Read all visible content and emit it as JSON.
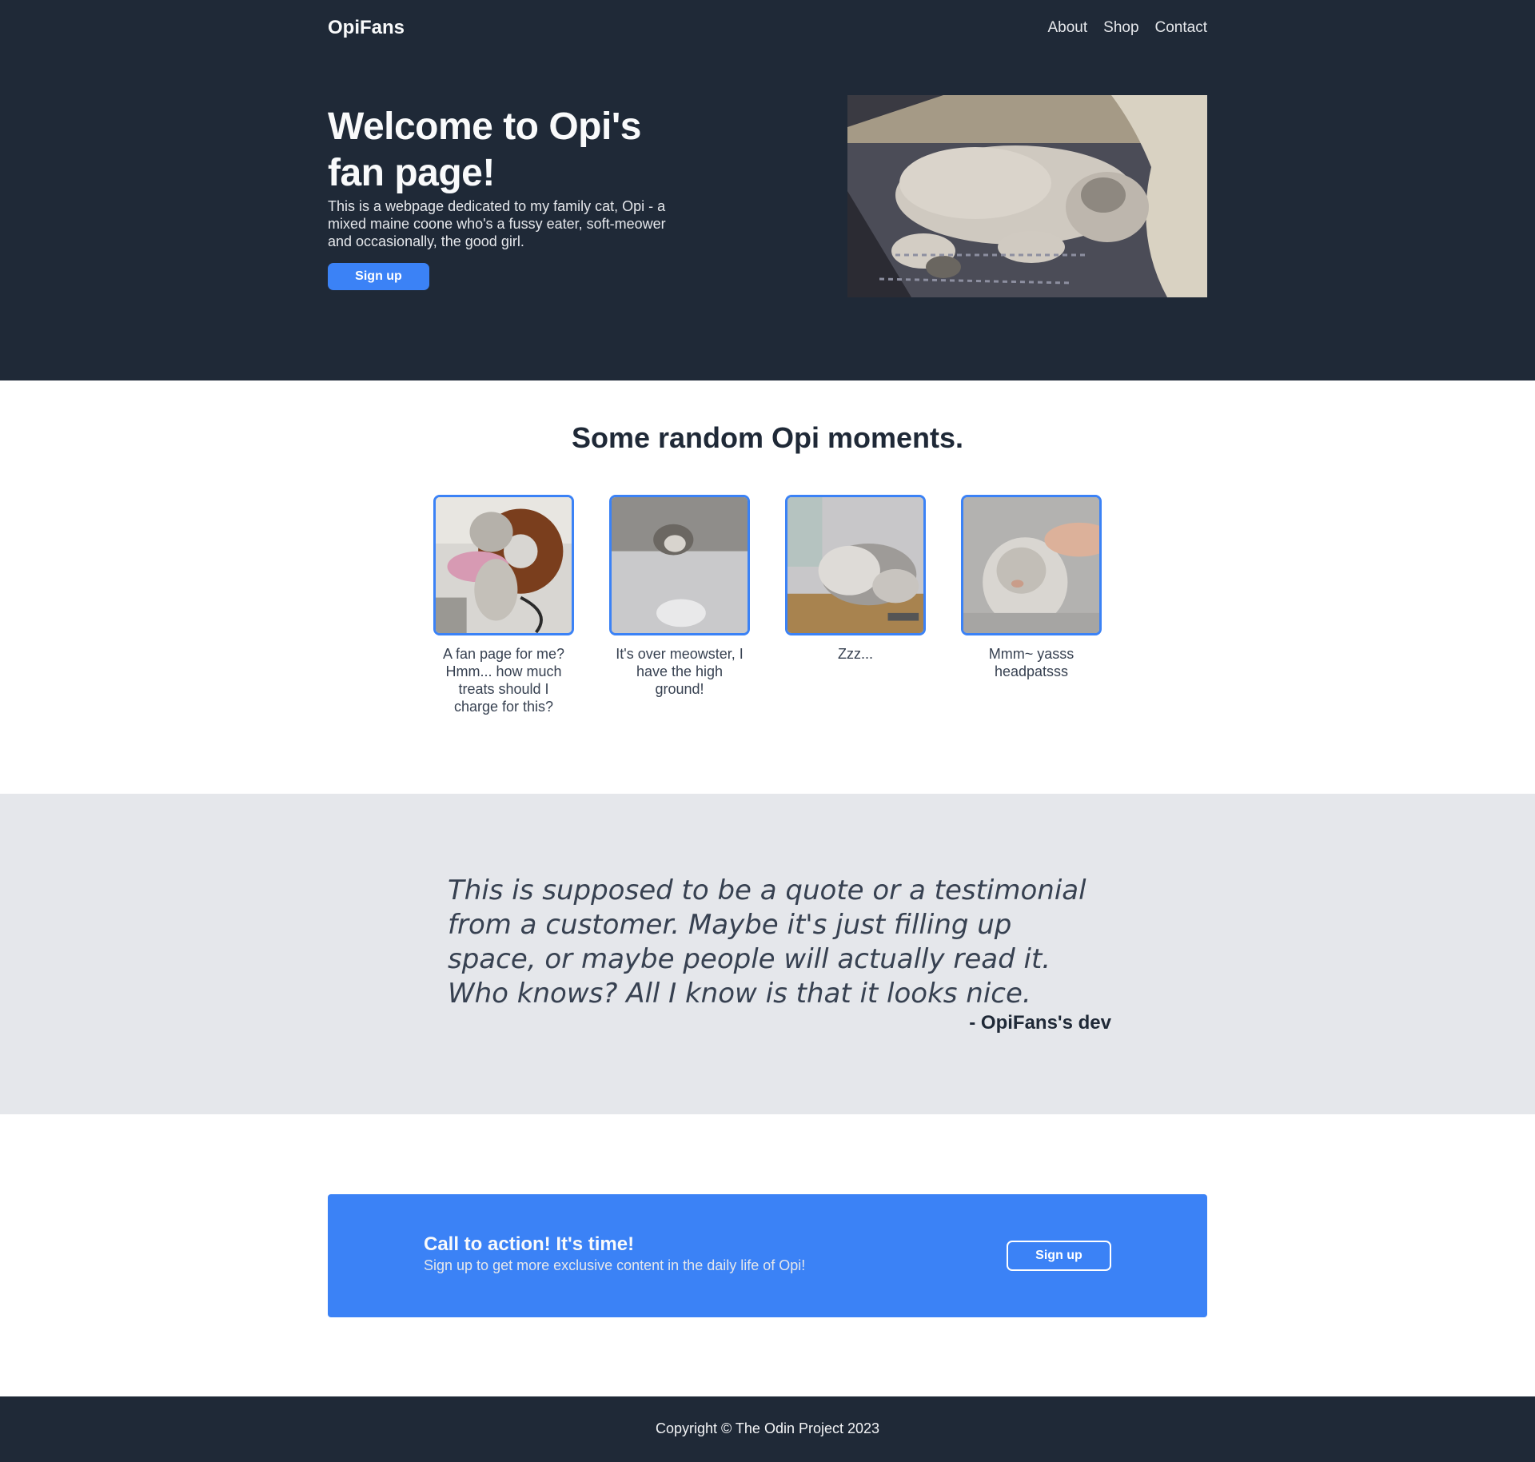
{
  "header": {
    "logo": "OpiFans",
    "nav": [
      "About",
      "Shop",
      "Contact"
    ]
  },
  "hero": {
    "title": "Welcome to Opi's fan page!",
    "text": "This is a webpage dedicated to my family cat, Opi - a mixed maine coone who's a fussy eater, soft-meower and occasionally, the good girl.",
    "button_label": "Sign up"
  },
  "moments": {
    "title": "Some random Opi moments.",
    "items": [
      {
        "caption": "A fan page for me? Hmm... how much treats should I charge for this?"
      },
      {
        "caption": "It's over meowster, I have the high ground!"
      },
      {
        "caption": "Zzz..."
      },
      {
        "caption": "Mmm~ yasss headpatsss"
      }
    ]
  },
  "quote": {
    "text": "This is supposed to be a quote or a testimonial from a customer. Maybe it's just filling up space, or maybe people will actually read it. Who knows? All I know is that it looks nice.",
    "author": "- OpiFans's dev"
  },
  "cta": {
    "title": "Call to action! It's time!",
    "text": "Sign up to get more exclusive content in the daily life of Opi!",
    "button_label": "Sign up"
  },
  "footer": {
    "text": "Copyright © The Odin Project 2023"
  },
  "colors": {
    "dark": "#1f2937",
    "accent": "#3b82f6",
    "quote_bg": "#e5e7eb"
  }
}
